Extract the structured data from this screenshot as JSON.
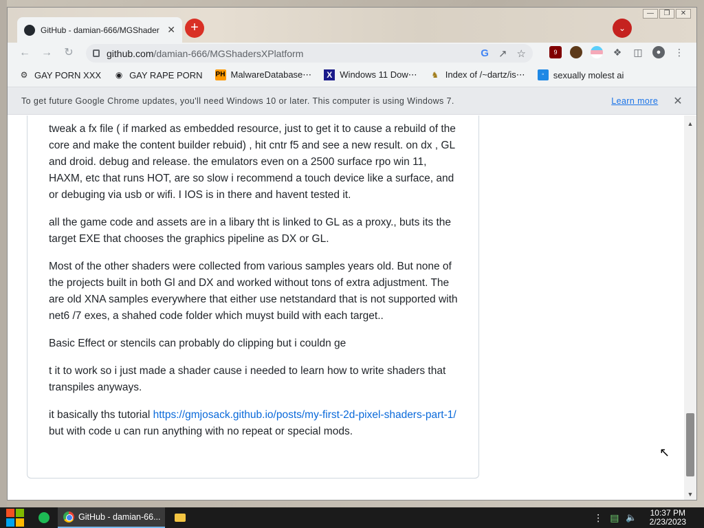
{
  "browser": {
    "tab_title": "GitHub - damian-666/MGShader",
    "url_host": "github.com",
    "url_path": "/damian-666/MGShadersXPlatform",
    "ublock_count": "9"
  },
  "bookmarks": [
    {
      "label": "GAY PORN XXX",
      "icon": "gear-icon"
    },
    {
      "label": "GAY RAPE PORN",
      "icon": "globe-icon"
    },
    {
      "label": "MalwareDatabase⋯",
      "icon": "ph-icon"
    },
    {
      "label": "Windows 11 Dow⋯",
      "icon": "x-icon"
    },
    {
      "label": "Index of /~dartz/is⋯",
      "icon": "directory-icon"
    },
    {
      "label": "sexually molest ai",
      "icon": "ai-icon"
    }
  ],
  "infobar": {
    "message": "To get future Google Chrome updates, you'll need Windows 10 or later. This computer is using Windows 7.",
    "learn_more": "Learn more"
  },
  "article": {
    "p1": "tweak a fx file ( if marked as embedded resource, just to get it to cause a rebuild of the core and make the content builder rebuid) , hit cntr f5 and see a new result. on dx , GL and droid. debug and release. the emulators even on a 2500 surface rpo win 11, HAXM, etc that runs HOT, are so slow i recommend a touch device like a surface, and or debuging via usb or wifi. I IOS is in there and havent tested it.",
    "p2": "all the game code and assets are in a libary tht is linked to GL as a proxy., buts its the target EXE that chooses the graphics pipeline as DX or GL.",
    "p3": "Most of the other shaders were collected from various samples years old. But none of the projects built in both Gl and DX and worked without tons of extra adjustment. The are old XNA samples everywhere that either use netstandard that is not supported with net6 /7 exes, a shahed code folder which muyst build with each target..",
    "p4": "Basic Effect or stencils can probably do clipping but i couldn ge",
    "p5": "t it to work so i just made a shader cause i needed to learn how to write shaders that transpiles anyways.",
    "p6_before": "it basically ths tutorial ",
    "p6_link": "https://gmjosack.github.io/posts/my-first-2d-pixel-shaders-part-1/",
    "p6_after": " but with code u can run anything with no repeat or special mods."
  },
  "taskbar": {
    "chrome_label": "GitHub - damian-66...",
    "time": "10:37 PM",
    "date": "2/23/2023"
  }
}
